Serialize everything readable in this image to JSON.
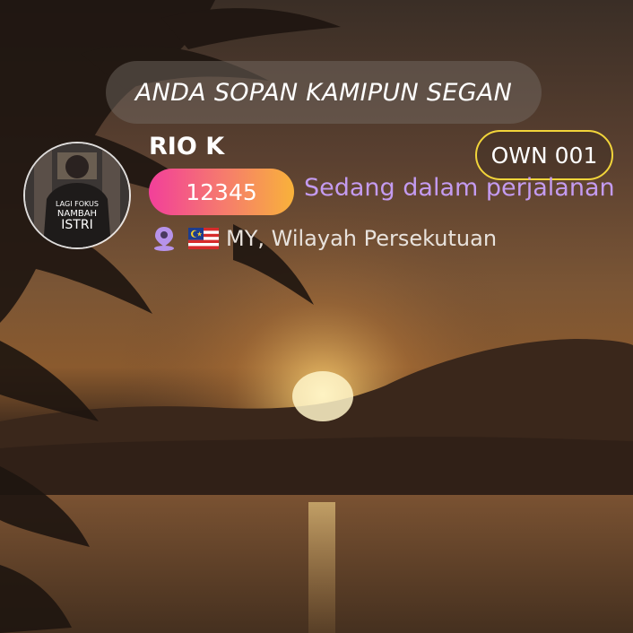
{
  "profile": {
    "bio": "ANDA SOPAN KAMIPUN SEGAN",
    "username": "RIO K",
    "badge": "OWN 001",
    "user_id": "12345",
    "status": "Sedang dalam perjalanan",
    "location": "MY, Wilayah Persekutuan",
    "avatar": {
      "shirt_text": [
        "LAGI FOKUS",
        "NAMBAH",
        "ISTRI"
      ]
    }
  },
  "icons": {
    "location": "location-pin-icon",
    "flag": "malaysia-flag-icon"
  },
  "colors": {
    "badge_border": "#f2d53a",
    "status_text": "#c49bf0",
    "id_gradient": [
      "#f23f9a",
      "#f8b23a"
    ]
  }
}
